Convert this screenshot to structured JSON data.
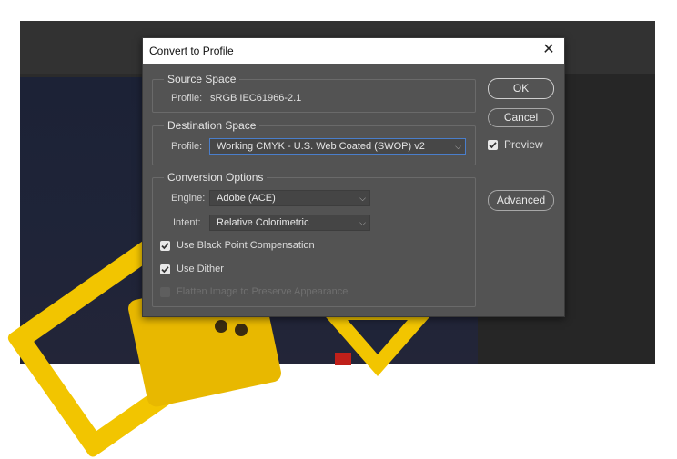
{
  "dialog": {
    "title": "Convert to Profile",
    "source_space": {
      "heading": "Source Space",
      "profile_label": "Profile:",
      "profile_value": "sRGB IEC61966-2.1"
    },
    "destination_space": {
      "heading": "Destination Space",
      "profile_label": "Profile:",
      "profile_selected": "Working CMYK - U.S. Web Coated (SWOP) v2"
    },
    "conversion_options": {
      "heading": "Conversion Options",
      "engine_label": "Engine:",
      "engine_selected": "Adobe (ACE)",
      "intent_label": "Intent:",
      "intent_selected": "Relative Colorimetric",
      "use_black_point": {
        "label": "Use Black Point Compensation",
        "checked": true
      },
      "use_dither": {
        "label": "Use Dither",
        "checked": true
      },
      "flatten_image": {
        "label": "Flatten Image to Preserve Appearance",
        "checked": false,
        "disabled": true
      }
    },
    "buttons": {
      "ok": "OK",
      "cancel": "Cancel",
      "advanced": "Advanced"
    },
    "preview": {
      "label": "Preview",
      "checked": true
    }
  },
  "colors": {
    "dialog_bg": "#535353",
    "focus_border": "#4a7ecb",
    "artwork_yellow": "#f2c500"
  }
}
